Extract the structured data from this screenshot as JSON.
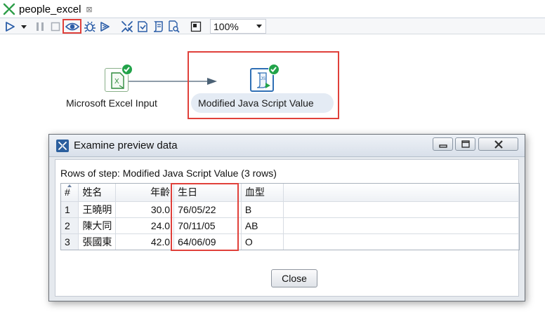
{
  "tab": {
    "title": "people_excel",
    "close_glyph": "⊠"
  },
  "toolbar": {
    "icons": [
      "run-icon",
      "run-dropdown-icon",
      "pause-icon",
      "stop-icon",
      "preview-icon",
      "debug-icon",
      "replay-icon",
      "verify-icon",
      "impact-icon",
      "sql-icon",
      "explore-db-icon",
      "show-results-icon"
    ],
    "zoom_value": "100%"
  },
  "canvas": {
    "steps": [
      {
        "label": "Microsoft Excel Input",
        "icon": "excel-input-icon",
        "status": "ok"
      },
      {
        "label": "Modified Java Script Value",
        "icon": "javascript-step-icon",
        "status": "ok"
      }
    ]
  },
  "dialog": {
    "title": "Examine preview data",
    "caption": "Rows of step: Modified Java Script Value (3 rows)",
    "columns": [
      "#",
      "姓名",
      "年齡",
      "生日",
      "血型"
    ],
    "rows": [
      [
        "1",
        "王曉明",
        "30.0",
        "76/05/22",
        "B"
      ],
      [
        "2",
        "陳大同",
        "24.0",
        "70/11/05",
        "AB"
      ],
      [
        "3",
        "張國東",
        "42.0",
        "64/06/09",
        "O"
      ]
    ],
    "close_label": "Close"
  },
  "colors": {
    "highlight": "#e0403a",
    "ok_badge": "#22a34a",
    "js_step": "#2f6fb5"
  }
}
